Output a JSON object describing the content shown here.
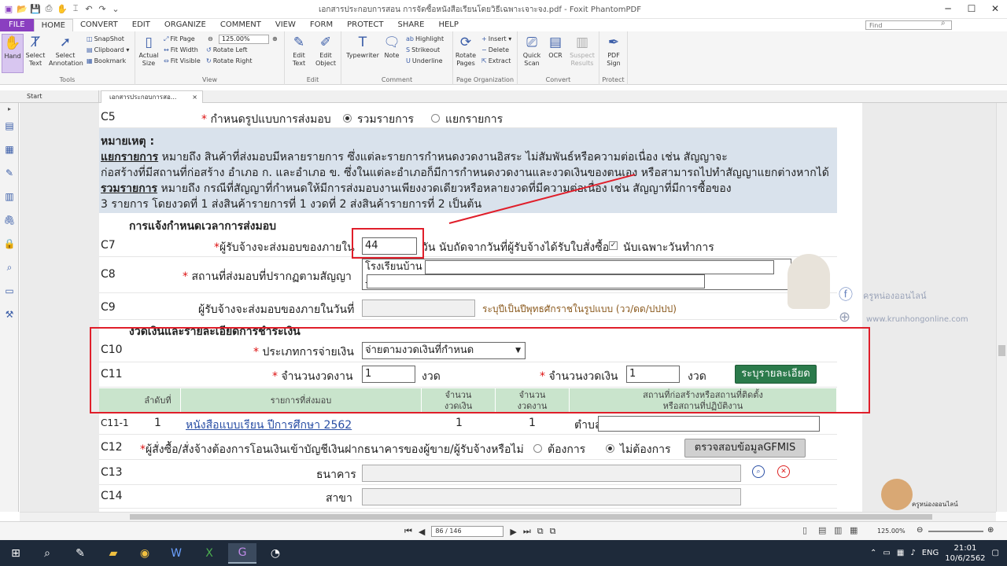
{
  "window": {
    "title": "เอกสารประกอบการสอน การจัดซื้อหนังสือเรียนโดยวิธีเฉพาะเจาะจง.pdf - Foxit PhantomPDF",
    "search_placeholder": "Find"
  },
  "menu": [
    "FILE",
    "HOME",
    "CONVERT",
    "EDIT",
    "ORGANIZE",
    "COMMENT",
    "VIEW",
    "FORM",
    "PROTECT",
    "SHARE",
    "HELP"
  ],
  "ribbon": {
    "tools": {
      "hand": "Hand",
      "select_text": "Select Text",
      "select_annotation": "Select Annotation",
      "snapshot": "SnapShot",
      "clipboard": "Clipboard",
      "bookmark": "Bookmark",
      "label": "Tools"
    },
    "view": {
      "actual_size": "Actual Size",
      "fit_page": "Fit Page",
      "fit_width": "Fit Width",
      "fit_visible": "Fit Visible",
      "zoom": "125.00%",
      "rotate_left": "Rotate Left",
      "rotate_right": "Rotate Right",
      "label": "View"
    },
    "edit": {
      "edit_text": "Edit Text",
      "edit_object": "Edit Object",
      "label": "Edit"
    },
    "comment": {
      "typewriter": "Typewriter",
      "note": "Note",
      "highlight": "Highlight",
      "strikeout": "Strikeout",
      "underline": "Underline",
      "label": "Comment"
    },
    "page_org": {
      "rotate_pages": "Rotate Pages",
      "insert": "Insert",
      "delete": "Delete",
      "extract": "Extract",
      "label": "Page Organization"
    },
    "convert": {
      "quick_scan": "Quick Scan",
      "ocr": "OCR",
      "suspect_results": "Suspect Results",
      "label": "Convert"
    },
    "protect": {
      "pdf_sign": "PDF Sign",
      "label": "Protect"
    }
  },
  "tabs": {
    "start": "Start",
    "doc": "เอกสารประกอบการสอ...",
    "close": "×"
  },
  "form": {
    "c5": {
      "code": "C5",
      "label": "กำหนดรูปแบบการส่งมอบ",
      "opt1": "รวมรายการ",
      "opt2": "แยกรายการ"
    },
    "note": {
      "head": "หมายเหตุ :",
      "l1a": "แยกรายการ",
      "l1b": " หมายถึง สินค้าที่ส่งมอบมีหลายรายการ ซึ่งแต่ละรายการกำหนดงวดงานอิสระ ไม่สัมพันธ์หรือความต่อเนื่อง เช่น สัญญาจะ",
      "l2": "ก่อสร้างที่มีสถานที่ก่อสร้าง อำเภอ ก. และอำเภอ ข. ซึ่งในแต่ละอำเภอก็มีการกำหนดงวดงานและงวดเงินของตนเอง หรือสามารถไปทำสัญญาแยกต่างหากได้",
      "l3a": "รวมรายการ",
      "l3b": " หมายถึง กรณีที่สัญญาที่กำหนดให้มีการส่งมอบงานเพียงงวดเดียวหรือหลายงวดที่มีความต่อเนื่อง เช่น สัญญาที่มีการซื้อของ",
      "l4": "3 รายการ โดยงวดที่ 1 ส่งสินค้ารายการที่ 1 งวดที่ 2 ส่งสินค้ารายการที่ 2 เป็นต้น"
    },
    "sec1": "การแจ้งกำหนดเวลาการส่งมอบ",
    "c7": {
      "code": "C7",
      "label": "ผู้รับจ้างจะส่งมอบของภายใน",
      "value": "44",
      "after": "วัน นับถัดจากวันที่ผู้รับจ้างได้รับใบสั่งซื้อ",
      "check": "✓",
      "chk_label": "นับเฉพาะวันทำการ"
    },
    "c8": {
      "code": "C8",
      "label": "สถานที่ส่งมอบที่ปรากฏตามสัญญา",
      "value": "โรงเรียนบ้าน",
      "dash": "-"
    },
    "c9": {
      "code": "C9",
      "label": "ผู้รับจ้างจะส่งมอบของภายในวันที่",
      "hint": "ระบุปีเป็นปีพุทธศักราชในรูปแบบ (วว/ดด/ปปปป)"
    },
    "sec2": "งวดเงินและรายละเอียดการชำระเงิน",
    "c10": {
      "code": "C10",
      "label": "ประเภทการจ่ายเงิน",
      "value": "จ่ายตามงวดเงินที่กำหนด",
      "arrow": "▼"
    },
    "c11": {
      "code": "C11",
      "label1": "จำนวนงวดงาน",
      "val1": "1",
      "unit1": "งวด",
      "label2": "จำนวนงวดเงิน",
      "val2": "1",
      "unit2": "งวด",
      "button": "ระบุรายละเอียด"
    },
    "table": {
      "headers": [
        "ลำดับที่",
        "รายการที่ส่งมอบ",
        "จำนวน\nงวดเงิน",
        "จำนวน\nงวดงาน",
        "สถานที่ก่อสร้างหรือสถานที่ติดตั้ง\nหรือสถานที่ปฏิบัติงาน"
      ],
      "row": {
        "code": "C11-1",
        "no": "1",
        "item": "หนังสือแบบเรียน ปีการศึกษา 2562",
        "pay": "1",
        "work": "1",
        "loc_label": "ตำบล"
      }
    },
    "c12": {
      "code": "C12",
      "label": "ผู้สั่งซื้อ/สั่งจ้างต้องการโอนเงินเข้าบัญชีเงินฝากธนาคารของผู้ขาย/ผู้รับจ้างหรือไม่",
      "opt1": "ต้องการ",
      "opt2": "ไม่ต้องการ",
      "button": "ตรวจสอบข้อมูลGFMIS"
    },
    "c13": {
      "code": "C13",
      "label": "ธนาคาร"
    },
    "c14": {
      "code": "C14",
      "label": "สาขา"
    }
  },
  "watermark": {
    "fb": "ครูหน่องออนไลน์",
    "web": "www.krunhongonline.com",
    "small": "ครูหน่องออนไลน์"
  },
  "status": {
    "page": "86 / 146",
    "zoom": "125.00%"
  },
  "taskbar": {
    "lang": "ENG",
    "time": "21:01",
    "date": "10/6/2562"
  }
}
